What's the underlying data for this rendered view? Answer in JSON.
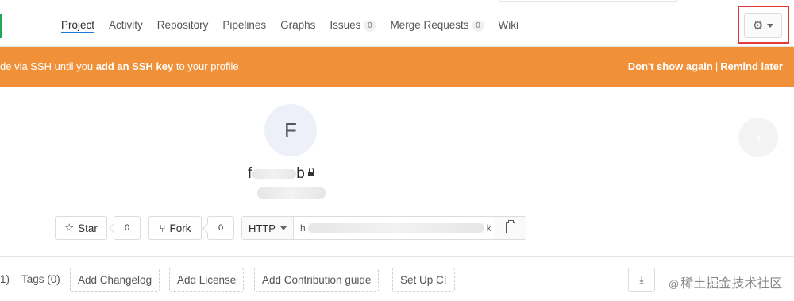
{
  "nav": {
    "tabs": [
      {
        "label": "Project",
        "active": true
      },
      {
        "label": "Activity"
      },
      {
        "label": "Repository"
      },
      {
        "label": "Pipelines"
      },
      {
        "label": "Graphs"
      },
      {
        "label": "Issues",
        "count": "0"
      },
      {
        "label": "Merge Requests",
        "count": "0"
      },
      {
        "label": "Wiki"
      }
    ],
    "settings_icon": "gear-icon"
  },
  "banner": {
    "text_before": "de via SSH until you ",
    "link": "add an SSH key",
    "text_after": " to your profile",
    "dismiss": "Don't show again",
    "separator": "|",
    "remind": "Remind later",
    "color": "#f0913a"
  },
  "project": {
    "avatar_letter": "F",
    "name_prefix": "f",
    "name_suffix": "b"
  },
  "actions": {
    "star_label": "Star",
    "star_count": "0",
    "fork_label": "Fork",
    "fork_count": "0",
    "protocol": "HTTP",
    "url_prefix": "h",
    "url_suffix": "k"
  },
  "bottom_links": {
    "partial": "1)",
    "tags": "Tags (0)",
    "add_changelog": "Add Changelog",
    "add_license": "Add License",
    "add_contribution": "Add Contribution guide",
    "setup_ci": "Set Up CI"
  },
  "watermark": {
    "at": "@",
    "text": "稀土掘金技术社区"
  }
}
